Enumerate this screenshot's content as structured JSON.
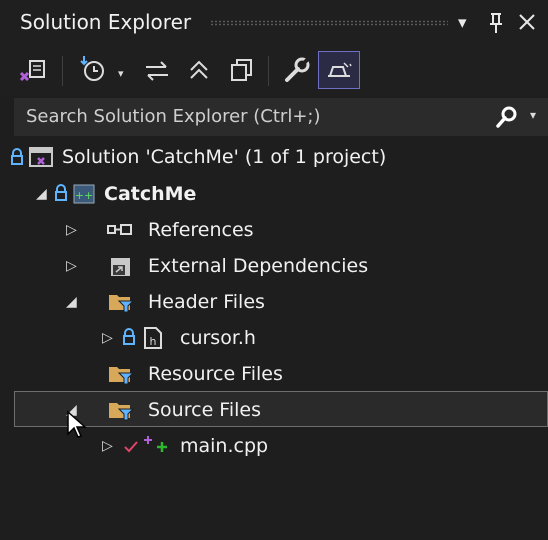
{
  "panel": {
    "title": "Solution Explorer"
  },
  "titlebar_icons": {
    "dropdown": "▾",
    "pin": "⊥",
    "close": "✕"
  },
  "toolbar": {
    "icons": [
      "switch-views-icon",
      "pending-changes-icon",
      "sync-icon",
      "collapse-all-icon",
      "copy-icon",
      "properties-icon",
      "preview-icon"
    ]
  },
  "search": {
    "placeholder": "Search Solution Explorer (Ctrl+;)"
  },
  "tree": {
    "solution": "Solution 'CatchMe' (1 of 1 project)",
    "project": "CatchMe",
    "references": "References",
    "external_dependencies": "External Dependencies",
    "header_files": "Header Files",
    "cursor_h": "cursor.h",
    "resource_files": "Resource Files",
    "source_files": "Source Files",
    "main_cpp": "main.cpp"
  },
  "colors": {
    "background": "#1e1e1e",
    "folder": "#d8a85a",
    "lock": "#5fb3ff",
    "selection_border": "#6e6e6e",
    "add_green": "#2eb82e",
    "check_red": "#e0456a"
  }
}
